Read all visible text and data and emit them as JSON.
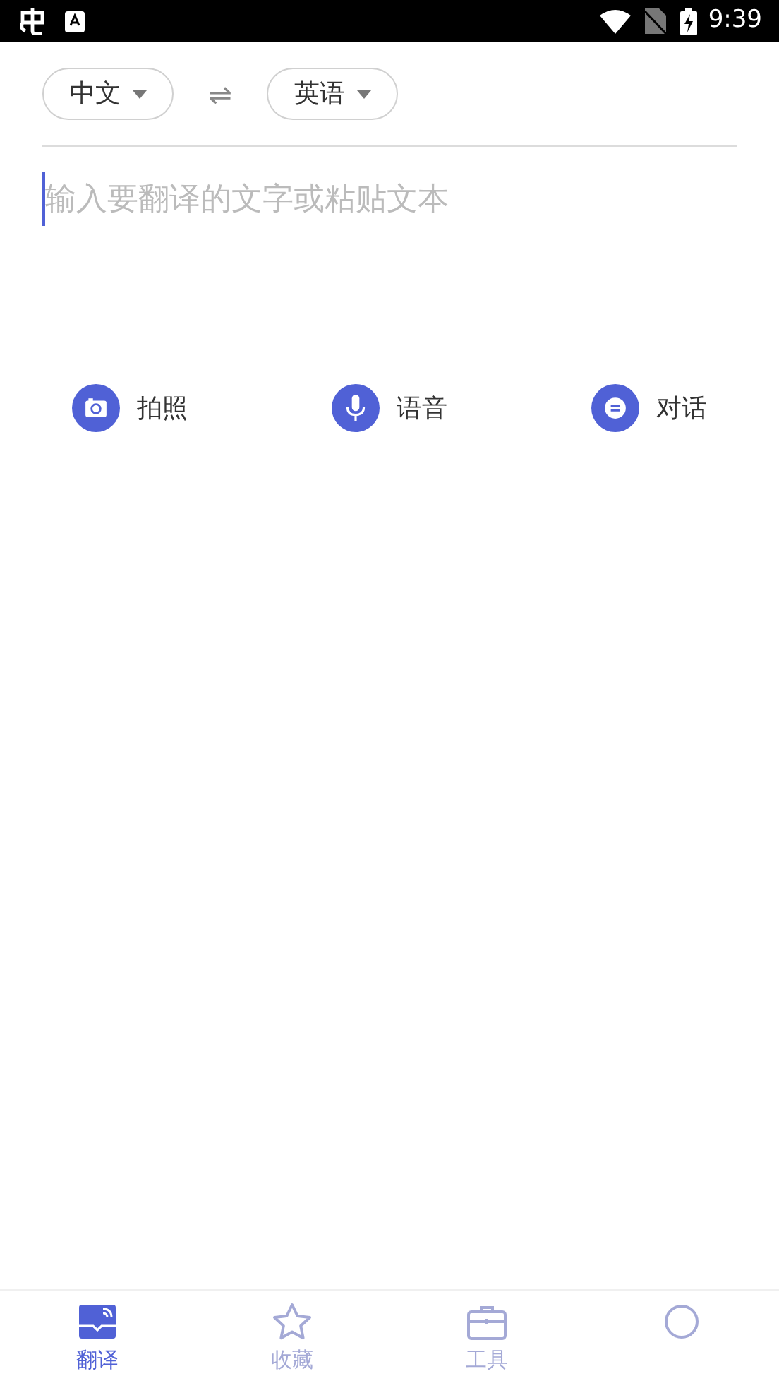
{
  "status_bar": {
    "time": "9:39"
  },
  "languages": {
    "source": "中文",
    "swap": "⇌",
    "target": "英语"
  },
  "input": {
    "placeholder": "输入要翻译的文字或粘贴文本"
  },
  "actions": [
    {
      "kind": "camera",
      "label": "拍照"
    },
    {
      "kind": "mic",
      "label": "语音"
    },
    {
      "kind": "chat",
      "label": "对话"
    }
  ],
  "tabs": [
    {
      "kind": "translate",
      "label": "翻译",
      "selected": true
    },
    {
      "kind": "star",
      "label": "收藏",
      "selected": false
    },
    {
      "kind": "toolbox",
      "label": "工具",
      "selected": false
    },
    {
      "kind": "profile",
      "selected": false
    }
  ]
}
